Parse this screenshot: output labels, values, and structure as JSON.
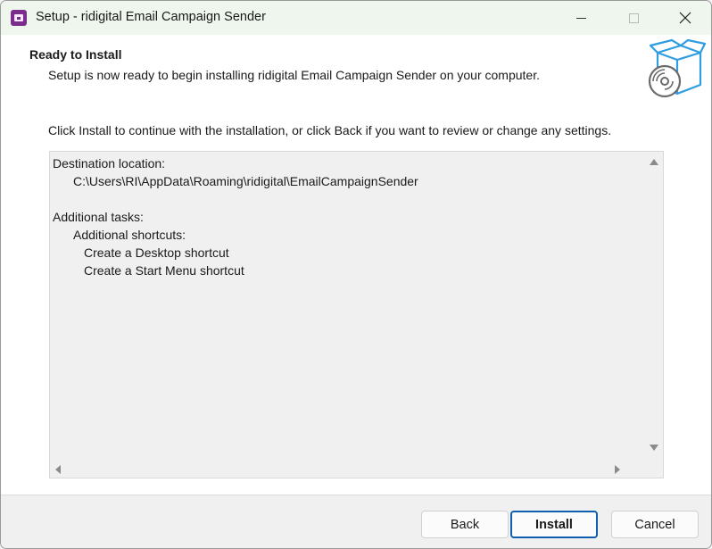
{
  "window": {
    "title": "Setup - ridigital Email Campaign Sender",
    "app_icon": "installer-app-icon",
    "controls": {
      "minimize_icon": "minimize-icon",
      "maximize_icon": "maximize-icon",
      "close_icon": "close-icon"
    }
  },
  "header": {
    "title": "Ready to Install",
    "subtitle": "Setup is now ready to begin installing ridigital Email Campaign Sender on your computer.",
    "icon": "software-box-disc-icon"
  },
  "content": {
    "instruction": "Click Install to continue with the installation, or click Back if you want to review or change any settings.",
    "memo": {
      "destination_heading": "Destination location:",
      "destination_path": "C:\\Users\\RI\\AppData\\Roaming\\ridigital\\EmailCampaignSender",
      "tasks_heading": "Additional tasks:",
      "shortcuts_heading": "Additional shortcuts:",
      "shortcut_desktop": "Create a Desktop shortcut",
      "shortcut_start_menu": "Create a Start Menu shortcut"
    }
  },
  "footer": {
    "back_label": "Back",
    "install_label": "Install",
    "cancel_label": "Cancel"
  },
  "colors": {
    "titlebar_bg": "#eef6ee",
    "accent": "#0f5fb0",
    "box_icon_blue": "#2f9de0"
  }
}
